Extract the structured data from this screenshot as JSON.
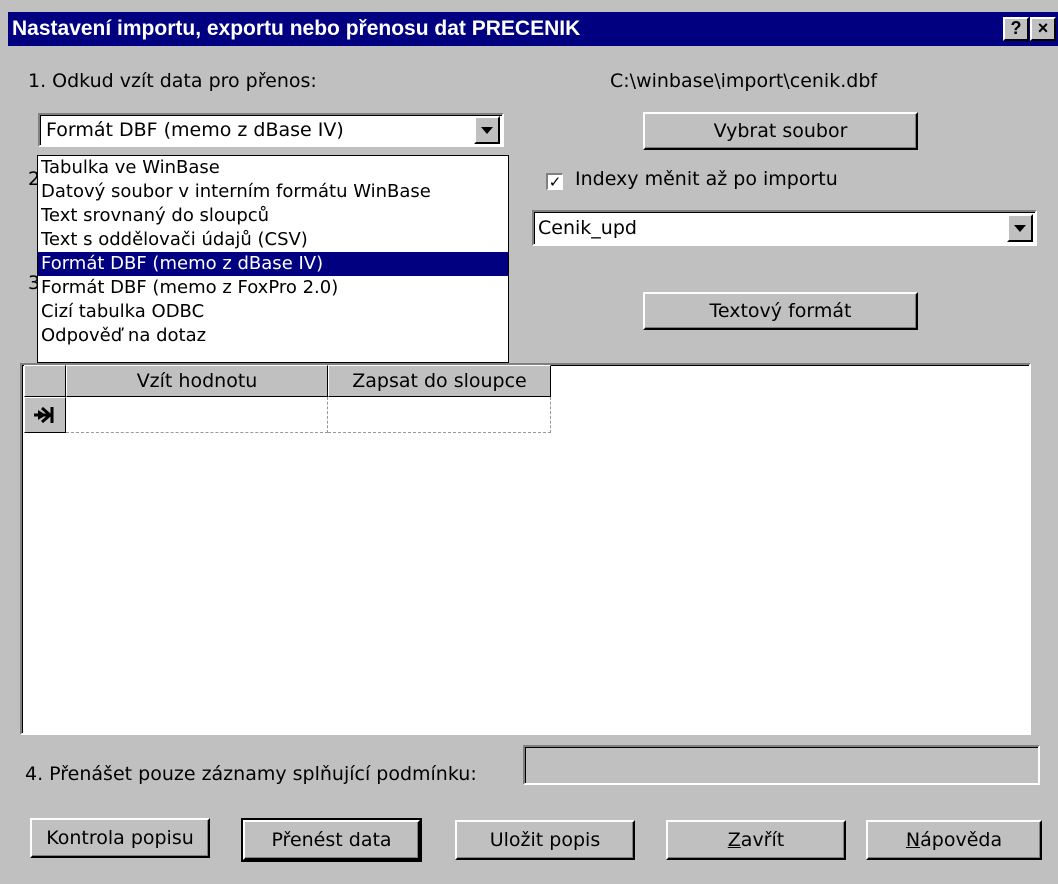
{
  "window": {
    "title": "Nastavení importu, exportu nebo přenosu dat PRECENIK",
    "help_btn": "?",
    "close_btn": "×"
  },
  "section1": {
    "label": "1. Odkud vzít data pro přenos:",
    "file_path": "C:\\winbase\\import\\cenik.dbf",
    "source_select_value": "Formát DBF (memo z dBase IV)",
    "select_file_button": "Vybrat soubor",
    "source_options": [
      "Tabulka ve WinBase",
      "Datový soubor v interním formátu WinBase",
      "Text srovnaný do sloupců",
      "Text s oddělovači údajů (CSV)",
      "Formát DBF (memo z dBase IV)",
      "Formát DBF (memo z FoxPro 2.0)",
      "Cizí tabulka ODBC",
      "Odpověď na dotaz"
    ],
    "selected_index": 4
  },
  "section2": {
    "label_prefix": "2",
    "index_checkbox_label": "Indexy měnit až po importu",
    "index_checked": true,
    "target_select_value": "Cenik_upd"
  },
  "section3": {
    "label_prefix": "3",
    "text_format_button": "Textový formát"
  },
  "grid": {
    "columns": [
      "Vzít hodnotu",
      "Zapsat do sloupce"
    ]
  },
  "section4": {
    "label": "4. Přenášet pouze záznamy splňující podmínku:",
    "condition_value": ""
  },
  "buttons": {
    "check": "Kontrola popisu",
    "transfer": "Přenést data",
    "save": "Uložit popis",
    "close_u": "Z",
    "close_rest": "avřít",
    "help_u": "N",
    "help_rest": "ápověda"
  },
  "icons": {
    "row_marker": "arrow-right-icon",
    "dropdown": "chevron-down-icon"
  }
}
